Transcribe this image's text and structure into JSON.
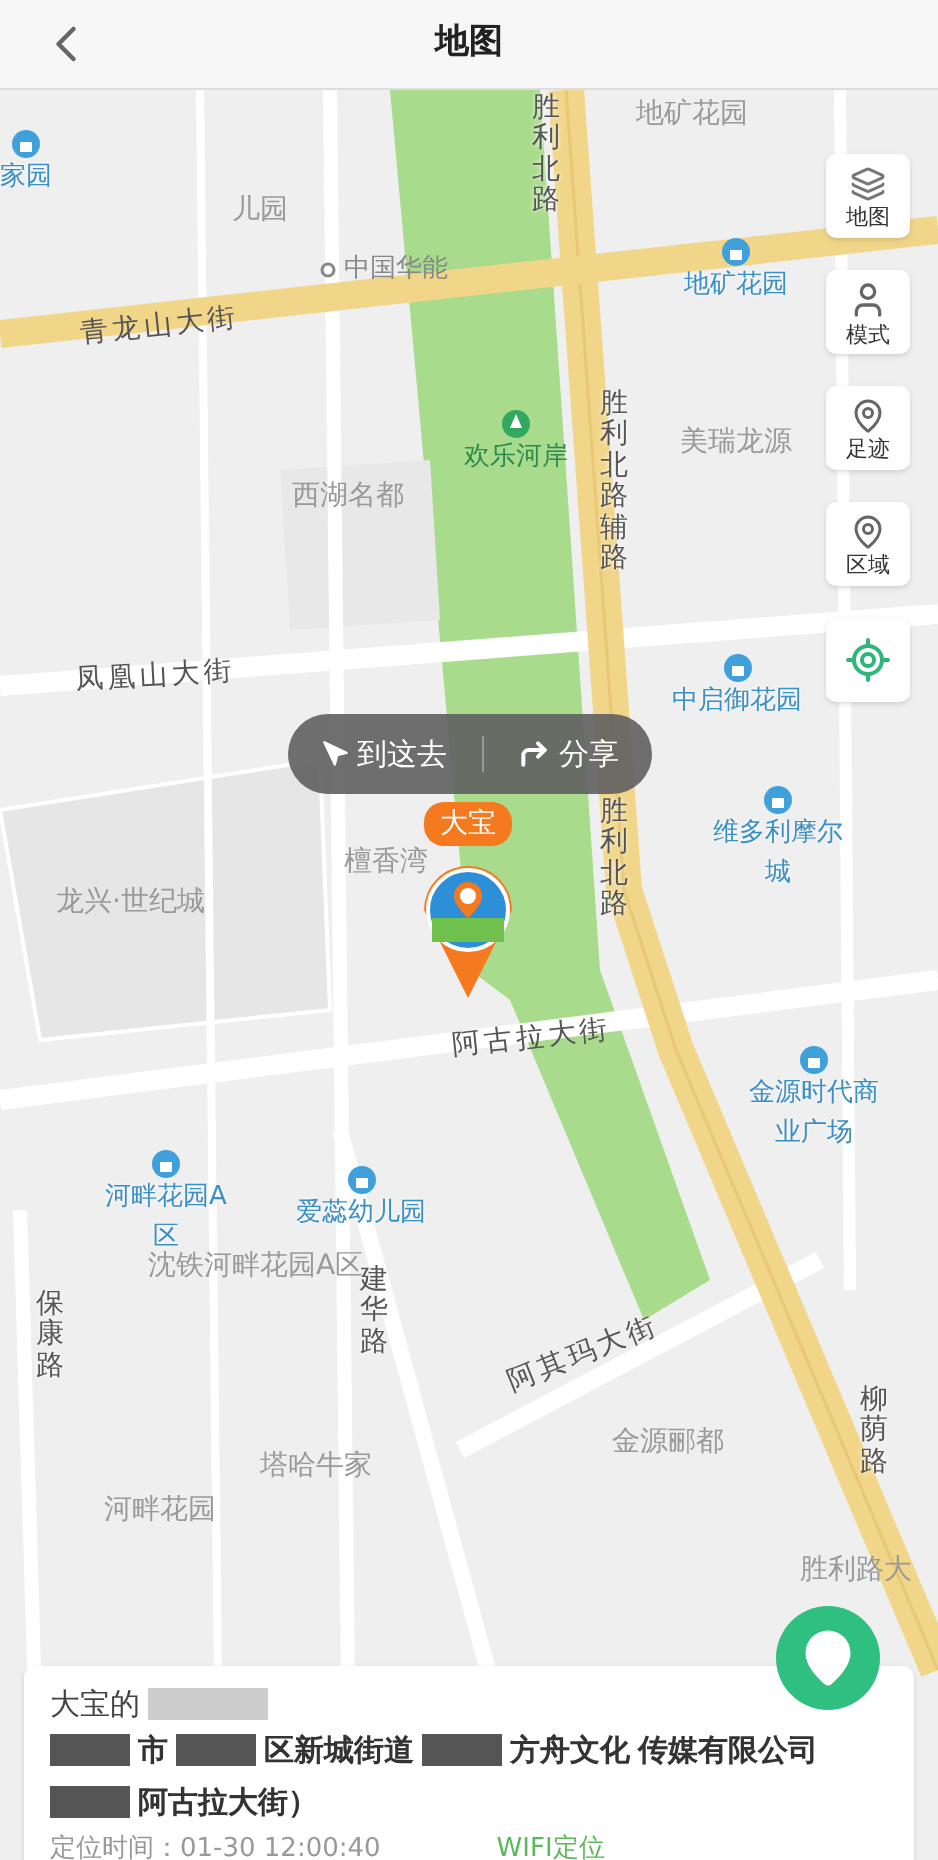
{
  "header": {
    "title": "地图"
  },
  "map_labels": [
    {
      "text": "家园",
      "kind": "poi"
    },
    {
      "text": "儿园",
      "kind": "area"
    },
    {
      "text": "中国华能",
      "kind": "dot"
    },
    {
      "text": "地矿花园",
      "kind": "area"
    },
    {
      "text": "地矿花园",
      "kind": "poi"
    },
    {
      "text": "青龙山大街",
      "kind": "road"
    },
    {
      "text": "胜利北路",
      "kind": "vroad"
    },
    {
      "text": "欢乐河岸",
      "kind": "park"
    },
    {
      "text": "胜利北路辅路",
      "kind": "vroad"
    },
    {
      "text": "美瑞龙源",
      "kind": "area"
    },
    {
      "text": "西湖名都",
      "kind": "area"
    },
    {
      "text": "凤凰山大街",
      "kind": "road"
    },
    {
      "text": "中启御花园",
      "kind": "poi"
    },
    {
      "text": "胜利北路",
      "kind": "vroad"
    },
    {
      "text": "维多利摩尔城",
      "kind": "poi"
    },
    {
      "text": "龙兴·世纪城",
      "kind": "area"
    },
    {
      "text": "檀香湾",
      "kind": "area"
    },
    {
      "text": "阿古拉大街",
      "kind": "road"
    },
    {
      "text": "金源时代商业广场",
      "kind": "poi"
    },
    {
      "text": "河畔花园A区",
      "kind": "poi"
    },
    {
      "text": "爱蕊幼儿园",
      "kind": "poi"
    },
    {
      "text": "沈铁河畔花园A区",
      "kind": "area"
    },
    {
      "text": "保康路",
      "kind": "vroad"
    },
    {
      "text": "建华路",
      "kind": "vroad"
    },
    {
      "text": "阿其玛大街",
      "kind": "road"
    },
    {
      "text": "塔哈牛家",
      "kind": "area"
    },
    {
      "text": "金源郦都",
      "kind": "area"
    },
    {
      "text": "柳荫路",
      "kind": "vroad"
    },
    {
      "text": "河畔花园",
      "kind": "area"
    },
    {
      "text": "胜利路大",
      "kind": "area"
    }
  ],
  "tools": [
    {
      "label": "地图",
      "kind": "layers"
    },
    {
      "label": "模式",
      "kind": "person"
    },
    {
      "label": "足迹",
      "kind": "track"
    },
    {
      "label": "区域",
      "kind": "area"
    },
    {
      "kind": "locate"
    }
  ],
  "popup": {
    "actions": [
      {
        "label": "到这去",
        "kind": "navigate"
      },
      {
        "label": "分享",
        "kind": "share"
      }
    ]
  },
  "marker": {
    "name": "大宝"
  },
  "card": {
    "title": "大宝的",
    "segments": [
      {
        "text": "市",
        "redacted_before": true
      },
      {
        "text": "区新城街道",
        "redacted_before": true
      },
      {
        "text": "方舟文化",
        "redacted_before": true
      },
      {
        "text": "传媒有限公司",
        "redacted_before": false
      },
      {
        "text": "阿古拉大街）",
        "redacted_before": true
      }
    ],
    "time": "定位时间：01-30 12:00:40",
    "source": "WIFI定位"
  }
}
